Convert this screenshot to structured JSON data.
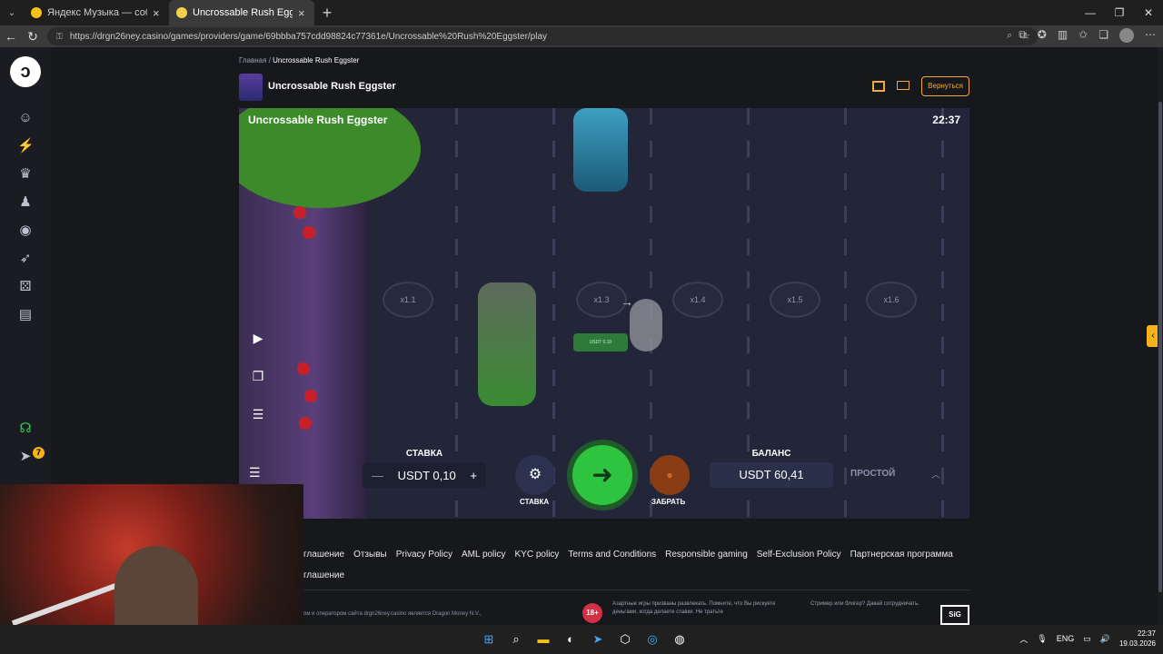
{
  "browser": {
    "tabs": [
      {
        "label": "Яндекс Музыка — собираем",
        "active": false
      },
      {
        "label": "Uncrossable Rush Eggster | D",
        "active": true
      }
    ],
    "new_tab": "+",
    "url": "https://drgn26ney.casino/games/providers/game/69bbba757cdd98824c77361e/Uncrossable%20Rush%20Eggster/play"
  },
  "breadcrumb": {
    "home": "Главная",
    "separator": "/",
    "current": "Uncrossable Rush Eggster"
  },
  "game_header": {
    "title": "Uncrossable Rush Eggster",
    "back_label": "Вернуться"
  },
  "game": {
    "title": "Uncrossable Rush Eggster",
    "clock": "22:37",
    "multipliers": [
      "x1.1",
      "x1.3",
      "x1.4",
      "x1.5",
      "x1.6"
    ],
    "chip_text": "USDT 0.10",
    "bet": {
      "label": "СТАВКА",
      "value": "USDT 0,10",
      "minus": "—",
      "plus": "+"
    },
    "settings_label": "СТАВКА",
    "cashout_label": "ЗАБРАТЬ",
    "balance": {
      "label": "БАЛАНС",
      "value": "USDT 60,41"
    },
    "mode": "ПРОСТОЙ"
  },
  "sidebar": {
    "badge": "7"
  },
  "footer": {
    "links": [
      "глашение",
      "Отзывы",
      "Privacy Policy",
      "AML policy",
      "KYC policy",
      "Terms and Conditions",
      "Responsible gaming",
      "Self-Exclusion Policy",
      "Партнерская программа"
    ],
    "line2": "глашение",
    "legal": "ом и оператором сайта drgn26ney.casino является Dragon Money N.V.,",
    "age": "18+",
    "disclaimer": "Азартные игры призваны развлекать. Помните, что Вы рискуете деньгами, когда делаете ставки. Не тратьте",
    "streamer": "Стример или блогер? Давай сотрудничать.",
    "sig": "SiG"
  },
  "taskbar": {
    "lang": "ENG",
    "time": "22:37",
    "date": "19.03.2026"
  },
  "colors": {
    "accent": "#f2a93b",
    "go": "#2fc43f",
    "badge": "#f6b21b"
  }
}
